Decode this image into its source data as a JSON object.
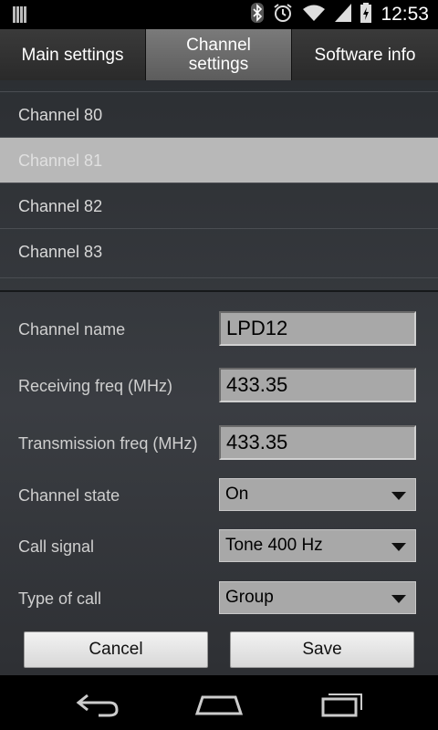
{
  "status_bar": {
    "time": "12:53"
  },
  "tabs": [
    {
      "label": "Main settings"
    },
    {
      "label": "Channel settings"
    },
    {
      "label": "Software info"
    }
  ],
  "channels": [
    {
      "label": "Channel 80"
    },
    {
      "label": "Channel 81"
    },
    {
      "label": "Channel 82"
    },
    {
      "label": "Channel 83"
    }
  ],
  "form": {
    "channel_name": {
      "label": "Channel name",
      "value": "LPD12"
    },
    "rx_freq": {
      "label": "Receiving freq (MHz)",
      "value": "433.35"
    },
    "tx_freq": {
      "label": "Transmission freq (MHz)",
      "value": "433.35"
    },
    "channel_state": {
      "label": "Channel state",
      "value": "On"
    },
    "call_signal": {
      "label": "Call signal",
      "value": "Tone 400 Hz"
    },
    "call_type": {
      "label": "Type of call",
      "value": "Group"
    }
  },
  "buttons": {
    "cancel": "Cancel",
    "save": "Save"
  }
}
